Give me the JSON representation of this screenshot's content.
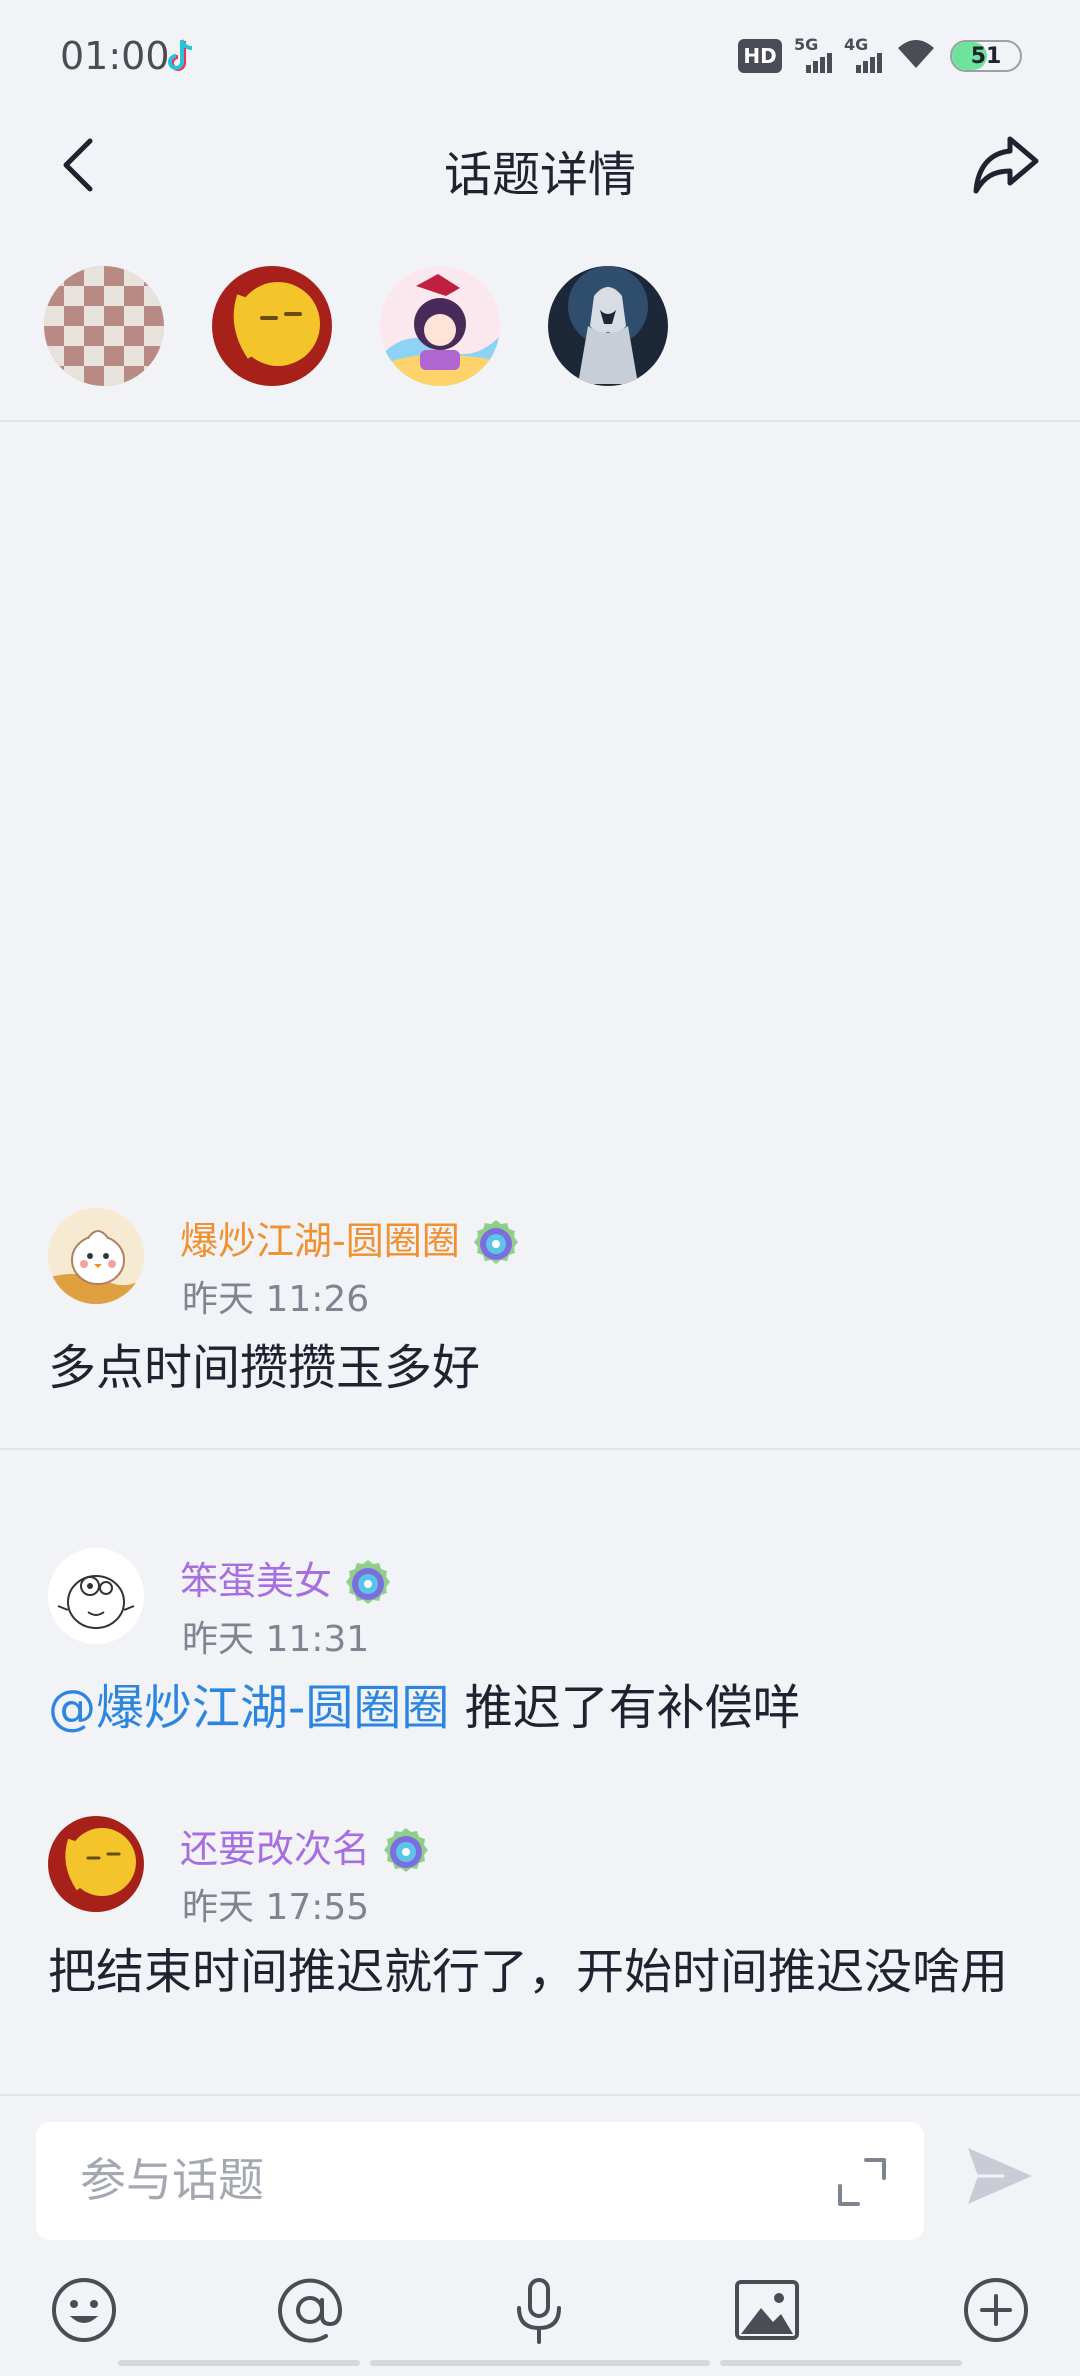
{
  "status_bar": {
    "time": "01:00",
    "app_icon": "tiktok-icon",
    "hd_label": "HD",
    "net_5g": "5G",
    "net_4g": "4G",
    "battery": "51",
    "battery_level": 0.51
  },
  "header": {
    "title": "话题详情",
    "back_icon": "chevron-left-icon",
    "share_icon": "share-icon"
  },
  "participants": [
    {
      "name": "participant-1",
      "icon": "checkered-avatar"
    },
    {
      "name": "participant-2",
      "icon": "red-smiley-avatar"
    },
    {
      "name": "participant-3",
      "icon": "anime-girl-avatar"
    },
    {
      "name": "participant-4",
      "icon": "assassin-avatar"
    }
  ],
  "messages": [
    {
      "name": "爆炒江湖-圆圈圈",
      "name_color": "#f0902e",
      "time": "昨天 11:26",
      "mention": "",
      "text": "多点时间攒攒玉多好"
    },
    {
      "name": "笨蛋美女",
      "name_color": "#a66ee0",
      "time": "昨天 11:31",
      "mention": "@爆炒江湖-圆圈圈",
      "text": " 推迟了有补偿咩"
    },
    {
      "name": "还要改次名",
      "name_color": "#a66ee0",
      "time": "昨天 17:55",
      "mention": "",
      "text": "把结束时间推迟就行了，开始时间推迟没啥用"
    }
  ],
  "composer": {
    "placeholder": "参与话题",
    "tools": [
      "emoji-icon",
      "at-icon",
      "microphone-icon",
      "image-icon",
      "plus-circle-icon"
    ]
  },
  "colors": {
    "background": "#f2f3f7",
    "mention": "#2c86e0",
    "accent_orange": "#f0902e",
    "accent_purple": "#a66ee0"
  }
}
